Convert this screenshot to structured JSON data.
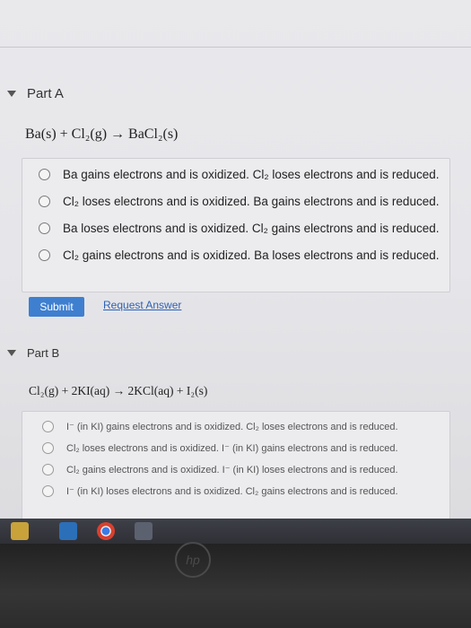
{
  "partA": {
    "label": "Part A",
    "equation": "Ba(s) + Cl₂(g) → BaCl₂(s)",
    "options": [
      {
        "text": "Ba gains electrons and is oxidized. Cl₂ loses electrons and is reduced."
      },
      {
        "text": "Cl₂ loses electrons and is oxidized. Ba gains electrons and is reduced."
      },
      {
        "text": "Ba loses electrons and is oxidized. Cl₂ gains electrons and is reduced."
      },
      {
        "text": "Cl₂ gains electrons and is oxidized. Ba loses electrons and is reduced."
      }
    ],
    "submit_label": "Submit",
    "request_answer_label": "Request Answer"
  },
  "partB": {
    "label": "Part B",
    "equation": "Cl₂(g) + 2KI(aq) → 2KCl(aq) + I₂(s)",
    "options": [
      {
        "text": "I⁻ (in KI) gains electrons and is oxidized. Cl₂ loses electrons and is reduced."
      },
      {
        "text": "Cl₂ loses electrons and is oxidized. I⁻ (in KI) gains electrons and is reduced."
      },
      {
        "text": "Cl₂ gains electrons and is oxidized. I⁻ (in KI) loses electrons and is reduced."
      },
      {
        "text": "I⁻ (in KI) loses electrons and is oxidized. Cl₂ gains electrons and is reduced."
      }
    ]
  },
  "colors": {
    "submit": "#3f7fd0",
    "link": "#2f62b5"
  },
  "taskbar": {
    "icons": [
      "file-explorer-icon",
      "edge-icon",
      "chrome-icon",
      "calendar-icon"
    ]
  },
  "laptop": {
    "brand": "hp"
  }
}
